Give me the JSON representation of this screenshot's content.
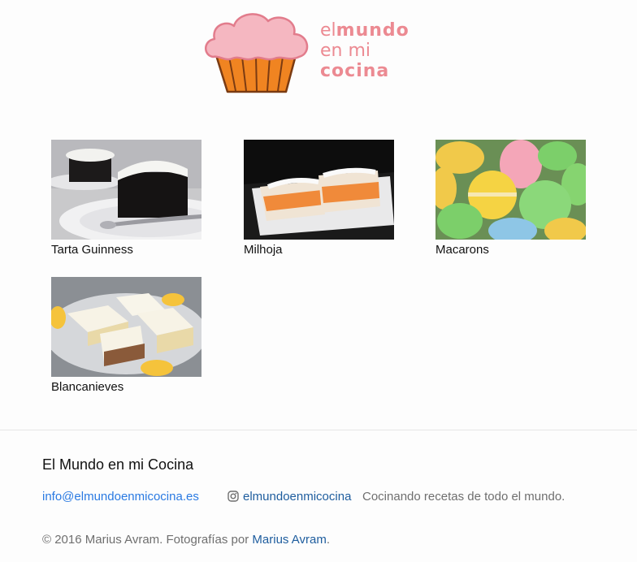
{
  "site": {
    "logo": {
      "line1_light": "el",
      "line1_bold": "mundo",
      "line2": "en mi",
      "line3": "cocina",
      "icon": "cupcake-logo",
      "color": "#ec8a92"
    }
  },
  "recipes": [
    {
      "title": "Tarta Guinness",
      "image": "chocolate-cake-photo"
    },
    {
      "title": "Milhoja",
      "image": "pastry-rolls-photo"
    },
    {
      "title": "Macarons",
      "image": "macarons-photo"
    },
    {
      "title": "Blancanieves",
      "image": "layered-cake-squares-photo"
    }
  ],
  "footer": {
    "title": "El Mundo en mi Cocina",
    "email": "info@elmundoenmicocina.es",
    "instagram_icon": "instagram-icon",
    "instagram_handle": "elmundoenmicocina",
    "tagline": "Cocinando recetas de todo el mundo.",
    "copyright_prefix": "© 2016 Marius Avram. Fotografías por ",
    "photographer": "Marius Avram",
    "copyright_suffix": "."
  },
  "colors": {
    "link": "#2a7ae2",
    "link_dark": "#1e5d9e",
    "muted_text": "#6f6f6f",
    "divider": "#e6e6e6"
  }
}
